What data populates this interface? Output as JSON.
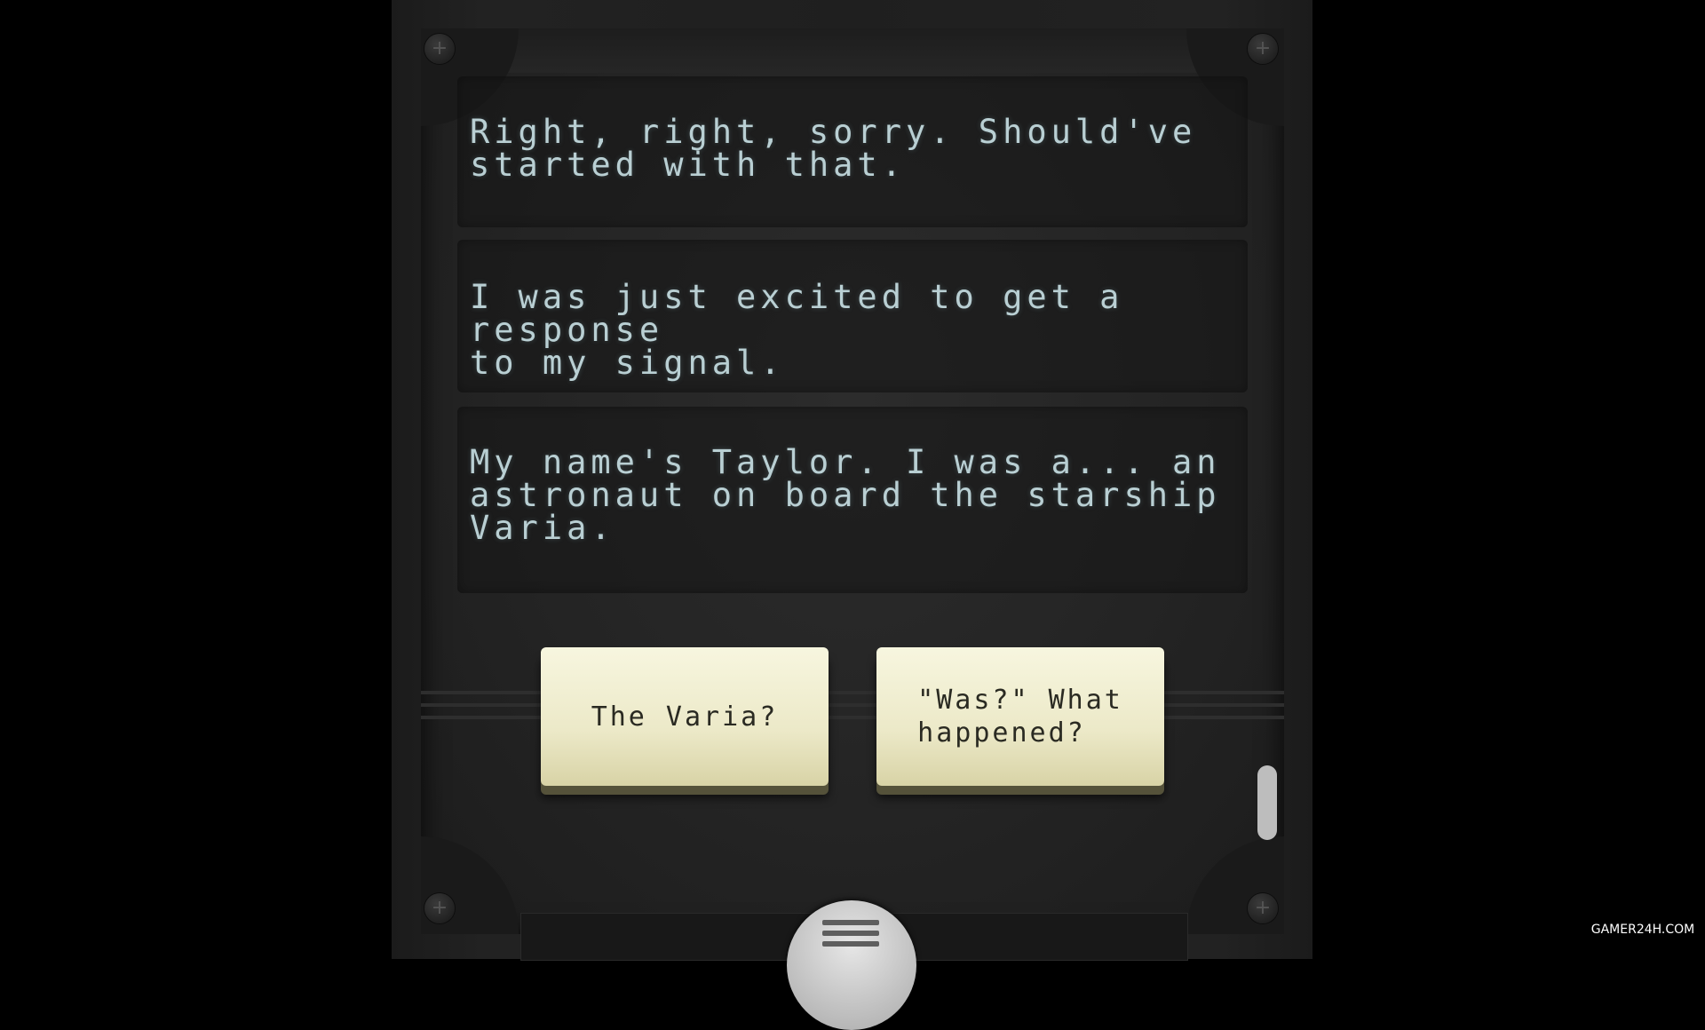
{
  "messages": [
    {
      "text": "Right, right, sorry. Should've\nstarted with that."
    },
    {
      "text": "I was just excited to get a response\nto my signal."
    },
    {
      "text": "My name's Taylor. I was a... an\nastronaut on board the starship\nVaria."
    }
  ],
  "choices": [
    {
      "label": "The Varia?"
    },
    {
      "label": "\"Was?\" What\nhappened?"
    }
  ],
  "icons": {
    "screw": "+",
    "menu": "hamburger-icon"
  },
  "watermark": "GAMER24H.COM",
  "colors": {
    "message_text": "#b9cfd3",
    "choice_bg": "#f0edd0",
    "background": "#000000"
  }
}
